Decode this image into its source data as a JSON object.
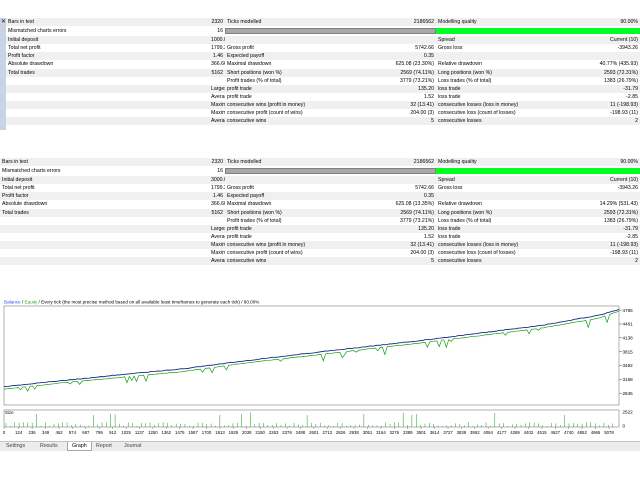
{
  "report_rows": [
    [
      "Bars in test",
      "2320",
      "Ticks modelled",
      "2186562",
      "Modelling quality",
      "90.00%"
    ],
    [
      "Mismatched charts errors",
      "16",
      "",
      "",
      "",
      ""
    ],
    [
      "Initial deposit",
      "1000.00",
      "",
      "",
      "Spread",
      "Current (10)"
    ],
    [
      "Total net profit",
      "1799.39",
      "Gross profit",
      "5742.66",
      "Gross loss",
      "-3943.26"
    ],
    [
      "Profit factor",
      "1.46",
      "Expected payoff",
      "0.35",
      "",
      ""
    ],
    [
      "Absolute drawdown",
      "366.66",
      "Maximal drawdown",
      "625.08 (23.30%)",
      "Relative drawdown",
      "40.77% (435.93)"
    ],
    [
      "Total trades",
      "5162",
      "Short positions (won %)",
      "2569 (74.11%)",
      "Long positions (won %)",
      "2593 (72.31%)"
    ],
    [
      "",
      "",
      "Profit trades (% of total)",
      "3779 (73.21%)",
      "Loss trades (% of total)",
      "1383 (26.79%)"
    ],
    [
      "",
      "Largest",
      "profit trade",
      "135.20",
      "loss trade",
      "-31.79"
    ],
    [
      "",
      "Average",
      "profit trade",
      "1.52",
      "loss trade",
      "-2.85"
    ],
    [
      "",
      "Maximum",
      "consecutive wins (profit in money)",
      "32 (13.41)",
      "consecutive losses (loss in money)",
      "11 (-198.93)"
    ],
    [
      "",
      "Maximal",
      "consecutive profit (count of wins)",
      "204.00 (3)",
      "consecutive loss (count of losses)",
      "-198.93 (11)"
    ],
    [
      "",
      "Average",
      "consecutive wins",
      "5",
      "consecutive losses",
      "2"
    ]
  ],
  "report_rows_2": [
    [
      "Bars in test",
      "2320",
      "Ticks modelled",
      "2186562",
      "Modelling quality",
      "90.00%"
    ],
    [
      "Mismatched charts errors",
      "16",
      "",
      "",
      "",
      ""
    ],
    [
      "Initial deposit",
      "3000.00",
      "",
      "",
      "Spread",
      "Current (10)"
    ],
    [
      "Total net profit",
      "1799.39",
      "Gross profit",
      "5742.66",
      "Gross loss",
      "-3943.26"
    ],
    [
      "Profit factor",
      "1.46",
      "Expected payoff",
      "0.35",
      "",
      ""
    ],
    [
      "Absolute drawdown",
      "366.66",
      "Maximal drawdown",
      "625.08 (13.35%)",
      "Relative drawdown",
      "14.29% (531.43)"
    ],
    [
      "Total trades",
      "5162",
      "Short positions (won %)",
      "2569 (74.11%)",
      "Long positions (won %)",
      "2593 (72.31%)"
    ],
    [
      "",
      "",
      "Profit trades (% of total)",
      "3779 (73.21%)",
      "Loss trades (% of total)",
      "1383 (26.79%)"
    ],
    [
      "",
      "Largest",
      "profit trade",
      "135.20",
      "loss trade",
      "-31.79"
    ],
    [
      "",
      "Average",
      "profit trade",
      "1.52",
      "loss trade",
      "-2.85"
    ],
    [
      "",
      "Maximum",
      "consecutive wins (profit in money)",
      "32 (13.41)",
      "consecutive losses (loss in money)",
      "11 (-198.93)"
    ],
    [
      "",
      "Maximal",
      "consecutive profit (count of wins)",
      "204.00 (3)",
      "consecutive loss (count of losses)",
      "-198.93 (11)"
    ],
    [
      "",
      "Average",
      "consecutive wins",
      "5",
      "consecutive losses",
      "2"
    ]
  ],
  "modelling_quality_fraction": 0.9,
  "pin_icon": "close-pin-icon",
  "chart": {
    "legend": [
      "Balance",
      " / ",
      "Equity",
      " / Every tick (the most precise method based on all available least timeframes to generate each tick) / 90.00%"
    ],
    "size_label": "Size",
    "y_ticks": [
      "4785",
      "4461",
      "4138",
      "3815",
      "3492",
      "3168",
      "2845"
    ],
    "size_ticks": [
      "2522",
      "0"
    ],
    "x_ticks": [
      "0",
      "124",
      "236",
      "349",
      "462",
      "574",
      "687",
      "799",
      "912",
      "1025",
      "1137",
      "1250",
      "1362",
      "1475",
      "1587",
      "1700",
      "1813",
      "1925",
      "2038",
      "2150",
      "2263",
      "2376",
      "2488",
      "2601",
      "2713",
      "2826",
      "2938",
      "3051",
      "3164",
      "3276",
      "3389",
      "3501",
      "3614",
      "3727",
      "3839",
      "3952",
      "4064",
      "4177",
      "4289",
      "4402",
      "4515",
      "4627",
      "4740",
      "4852",
      "4965",
      "5078"
    ],
    "colors": {
      "balance": "#1a2a88",
      "equity": "#12a012",
      "legend_balance": "#2b4fe0",
      "legend_equity": "#2aa02a"
    }
  },
  "chart_data": {
    "type": "line",
    "title": "Balance / Equity / Every tick (the most precise method based on all available least timeframes to generate each tick) / 90.00%",
    "xlabel": "",
    "ylabel": "",
    "xlim": [
      0,
      5162
    ],
    "ylim": [
      2570,
      4880
    ],
    "series": [
      {
        "name": "Balance",
        "x": [
          0,
          500,
          1000,
          1500,
          2000,
          2500,
          3000,
          3500,
          4000,
          4500,
          5000,
          5162
        ],
        "y": [
          3000,
          3143,
          3283,
          3414,
          3593,
          3760,
          3919,
          4075,
          4251,
          4422,
          4670,
          4799
        ]
      },
      {
        "name": "Equity",
        "x": [
          0,
          500,
          1000,
          1500,
          2000,
          2500,
          3000,
          3500,
          4000,
          4500,
          5000,
          5162
        ],
        "y": [
          2940,
          3090,
          3220,
          3350,
          3540,
          3700,
          3860,
          4020,
          4190,
          4360,
          4600,
          4760
        ]
      }
    ]
  },
  "tabs": [
    "Settings",
    "Results",
    "Graph",
    "Report",
    "Journal"
  ],
  "active_tab": "Graph"
}
